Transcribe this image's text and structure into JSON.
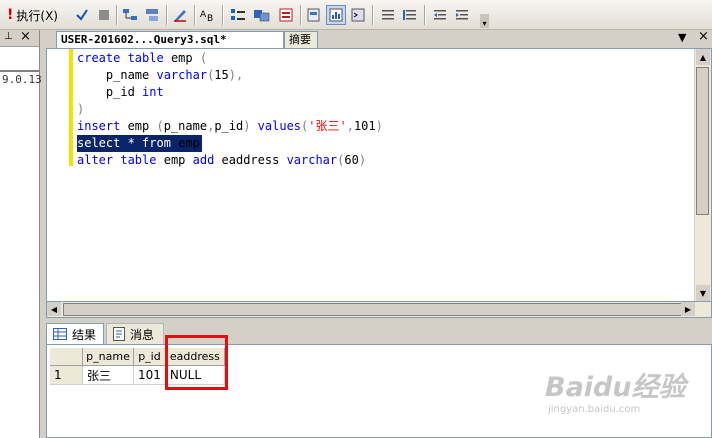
{
  "toolbar": {
    "execute_label": "执行(X)"
  },
  "left_panel": {
    "version_text": "9.0.13"
  },
  "editor": {
    "active_tab": "USER-201602...Query3.sql*",
    "inactive_tab": "摘要",
    "lines": [
      {
        "segments": [
          {
            "t": "create ",
            "c": "kw"
          },
          {
            "t": "table ",
            "c": "kw"
          },
          {
            "t": "emp ",
            "c": "fn"
          },
          {
            "t": "(",
            "c": "gray"
          }
        ]
      },
      {
        "segments": [
          {
            "t": "    p_name ",
            "c": "fn"
          },
          {
            "t": "varchar",
            "c": "kw"
          },
          {
            "t": "(",
            "c": "gray"
          },
          {
            "t": "15",
            "c": "num"
          },
          {
            "t": "),",
            "c": "gray"
          }
        ]
      },
      {
        "segments": [
          {
            "t": "    p_id ",
            "c": "fn"
          },
          {
            "t": "int",
            "c": "kw"
          }
        ]
      },
      {
        "segments": [
          {
            "t": ")",
            "c": "gray"
          }
        ]
      },
      {
        "segments": [
          {
            "t": "insert ",
            "c": "kw"
          },
          {
            "t": "emp ",
            "c": "fn"
          },
          {
            "t": "(",
            "c": "gray"
          },
          {
            "t": "p_name",
            "c": "fn"
          },
          {
            "t": ",",
            "c": "gray"
          },
          {
            "t": "p_id",
            "c": "fn"
          },
          {
            "t": ") ",
            "c": "gray"
          },
          {
            "t": "values",
            "c": "kw"
          },
          {
            "t": "(",
            "c": "gray"
          },
          {
            "t": "'张三'",
            "c": "str"
          },
          {
            "t": ",",
            "c": "gray"
          },
          {
            "t": "101",
            "c": "num"
          },
          {
            "t": ")",
            "c": "gray"
          }
        ]
      },
      {
        "selected": true,
        "segments": [
          {
            "t": "select ",
            "c": "kw"
          },
          {
            "t": "* ",
            "c": "gray"
          },
          {
            "t": "from ",
            "c": "kw"
          },
          {
            "t": "emp",
            "c": "fn"
          }
        ]
      },
      {
        "segments": [
          {
            "t": "alter ",
            "c": "kw"
          },
          {
            "t": "table ",
            "c": "kw"
          },
          {
            "t": "emp ",
            "c": "fn"
          },
          {
            "t": "add ",
            "c": "kw"
          },
          {
            "t": "eaddress ",
            "c": "fn"
          },
          {
            "t": "varchar",
            "c": "kw"
          },
          {
            "t": "(",
            "c": "gray"
          },
          {
            "t": "60",
            "c": "num"
          },
          {
            "t": ")",
            "c": "gray"
          }
        ]
      }
    ]
  },
  "results": {
    "tab_results": "结果",
    "tab_messages": "消息",
    "columns": [
      "p_name",
      "p_id",
      "eaddress"
    ],
    "rows": [
      {
        "num": "1",
        "cells": [
          "张三",
          "101",
          "NULL"
        ]
      }
    ]
  },
  "watermark": {
    "brand": "Baidu经验",
    "url": "jingyan.baidu.com"
  },
  "colors": {
    "selection": "#0a246a",
    "keyword": "#0000ff",
    "string": "#ff0000",
    "highlight_box": "#e01010"
  }
}
